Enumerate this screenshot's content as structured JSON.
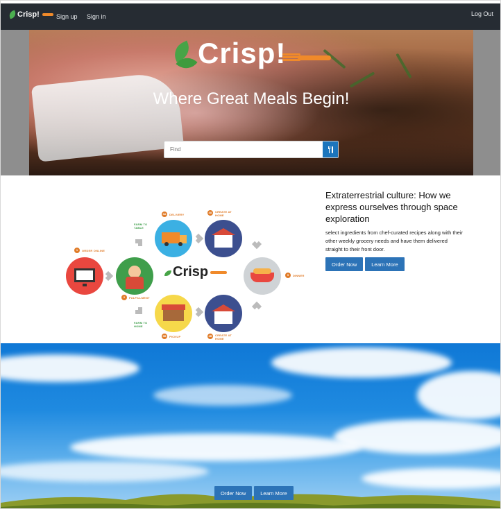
{
  "nav": {
    "brand": "Crisp!",
    "signup": "Sign up",
    "signin": "Sign in",
    "logout": "Log Out"
  },
  "hero": {
    "logo_text": "Crisp!",
    "title": "Where Great Meals Begin!",
    "search_placeholder": "Find",
    "search_icon": "utensils-icon"
  },
  "diagram": {
    "logo_text": "Crisp",
    "steps": [
      {
        "num": "1",
        "label": "ORDER ONLINE"
      },
      {
        "num": "2",
        "label": "FULFILLMENT"
      },
      {
        "num": "3A",
        "label": "DELIVERY"
      },
      {
        "num": "3B",
        "label": "PICKUP"
      },
      {
        "num": "4A",
        "label": "CREATE AT HOME"
      },
      {
        "num": "4B",
        "label": "CREATE AT HOME"
      },
      {
        "num": "5",
        "label": "DINNER"
      }
    ],
    "farm_top": "FARM TO TABLE",
    "farm_bottom": "FARM TO HOME"
  },
  "article": {
    "heading": "Extraterrestrial culture: How we express ourselves through space exploration",
    "body": "select ingredients from chef-curated recipes along with their other weekly grocery needs and have them delivered straight to their front door.",
    "order_button": "Order Now",
    "learn_button": "Learn More"
  },
  "sky": {
    "order_button": "Order Now",
    "learn_button": "Learn More"
  },
  "colors": {
    "navbar": "#262c33",
    "primary_button": "#2c73b7",
    "accent_orange": "#e07b28",
    "brand_green": "#47a447"
  }
}
